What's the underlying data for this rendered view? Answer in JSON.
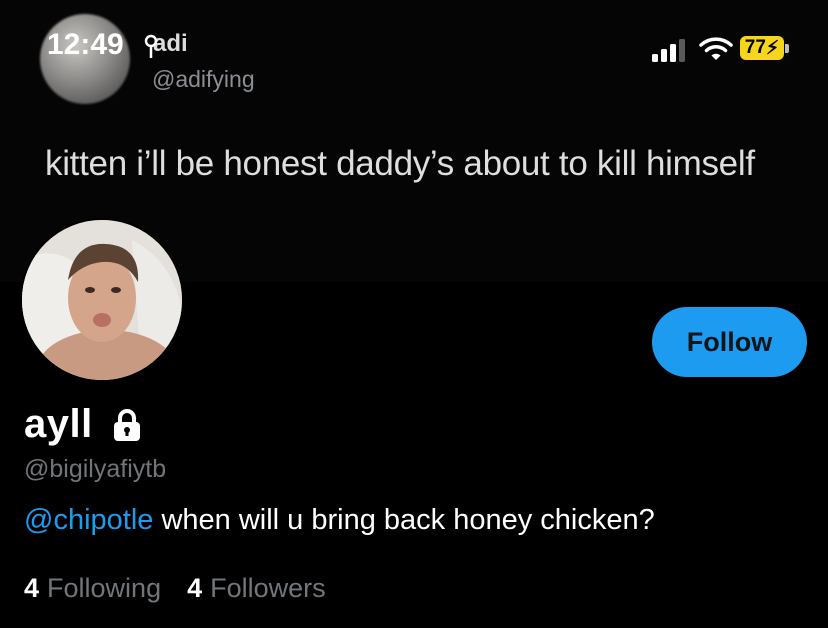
{
  "status_bar": {
    "time": "12:49",
    "battery_percent": "77"
  },
  "banner": {
    "name": "adi",
    "handle": "@adifying",
    "text": "kitten i’ll be honest daddy’s about to kill himself",
    "meta": "· · ·  ·  ·  · · · ·   ·  · ·  ·  ·  · ·"
  },
  "profile": {
    "display_name": "ayll",
    "handle": "@bigilyafiytb",
    "follow_label": "Follow",
    "bio_mention": "@chipotle",
    "bio_text": " when will u bring back honey chicken?",
    "following_count": "4",
    "following_label": "Following",
    "followers_count": "4",
    "followers_label": "Followers"
  },
  "colors": {
    "accent": "#1d9bf0",
    "background": "#000000",
    "secondary_text": "#71767b",
    "battery": "#f7d51c"
  },
  "icons": [
    "location-arrow-icon",
    "signal-icon",
    "wifi-icon",
    "battery-icon",
    "lock-icon"
  ]
}
